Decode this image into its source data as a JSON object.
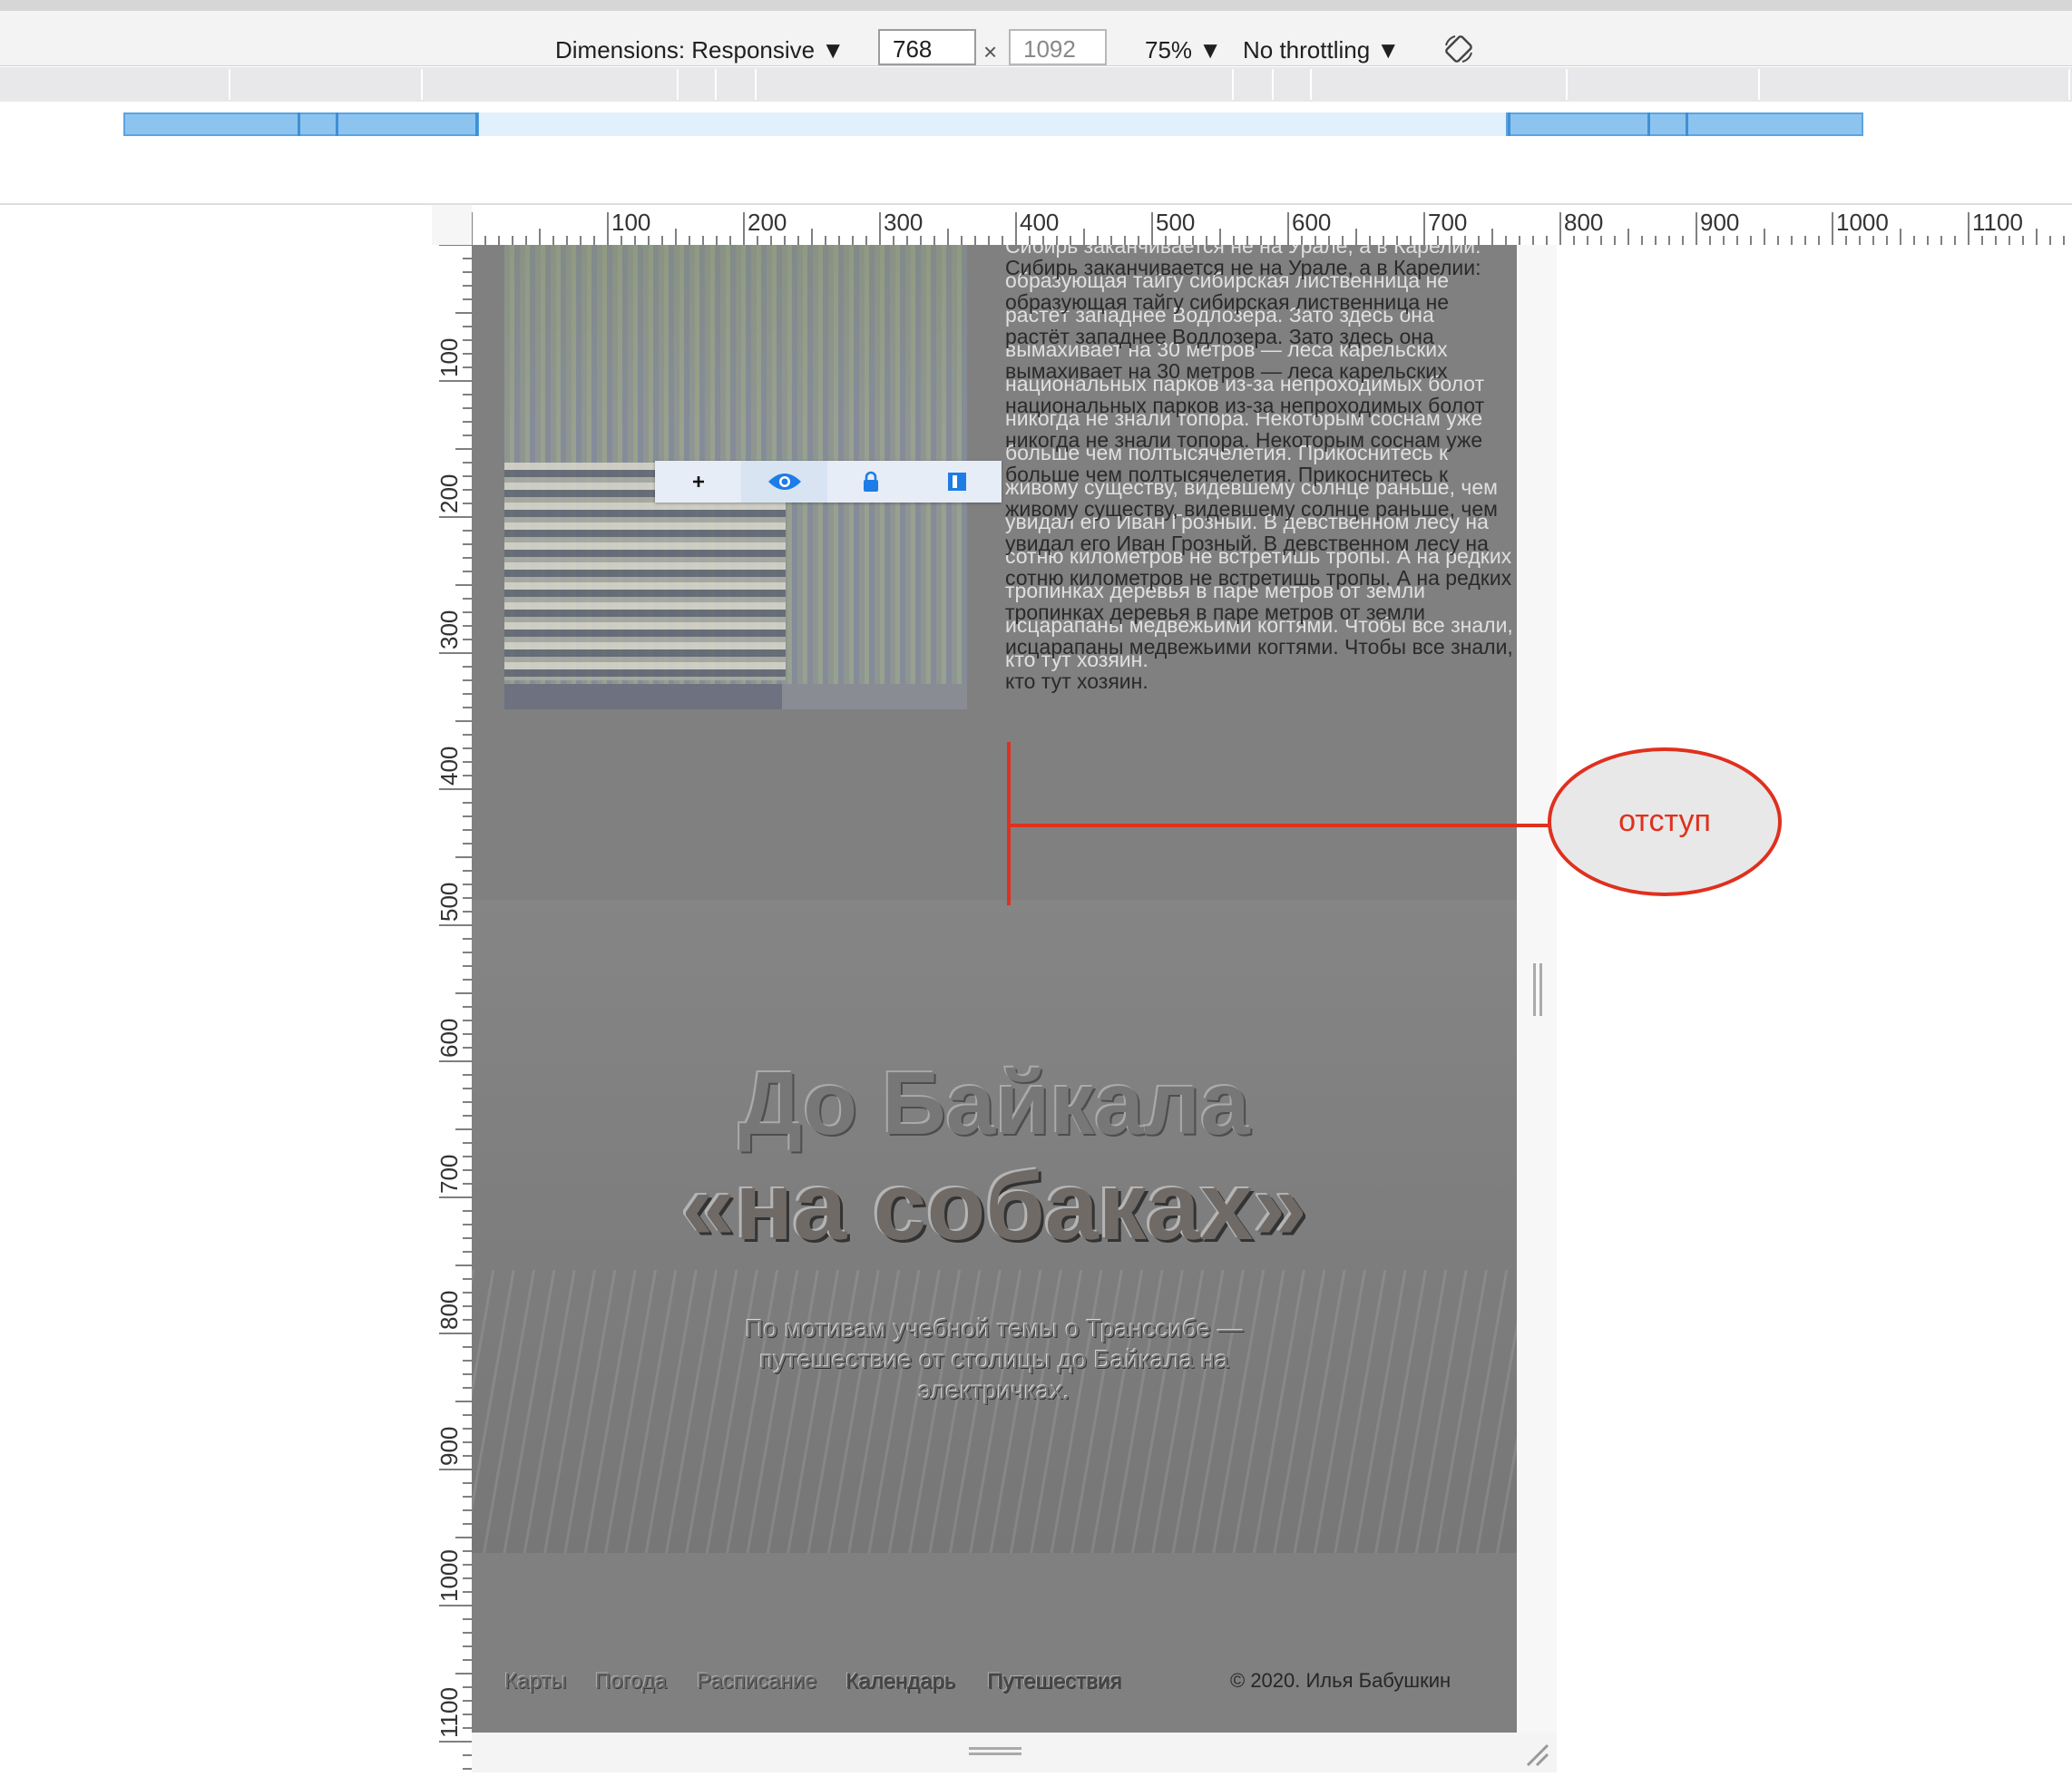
{
  "toolbar": {
    "dimensions_label": "Dimensions: Responsive ▼",
    "width_value": "768",
    "times": "×",
    "height_placeholder": "1092",
    "zoom": "75% ▼",
    "throttling": "No throttling ▼"
  },
  "ruler": {
    "top": [
      "100",
      "200",
      "300",
      "400",
      "500",
      "600",
      "700",
      "800",
      "900",
      "1000",
      "1100"
    ],
    "left": [
      "100",
      "200",
      "300",
      "400",
      "500",
      "600",
      "700",
      "800",
      "900",
      "1000",
      "1100"
    ]
  },
  "article": {
    "ghost": "Сибирь заканчивается не на Урале, а в Карелии: образующая тайгу сибирская лиственница не растёт западнее Водлозера. Зато здесь она вымахивает на 30 метров — леса карельских национальных парков из-за непроходимых болот никогда не знали топора. Некоторым соснам уже больше чем полтысячелетия. Прикоснитесь к живому существу, видевшему солнце раньше, чем увидал его Иван Грозный. В девственном лесу на сотню километров не встретишь тропы. А на редких тропинках деревья в паре метров от земли исцарапаны медвежьими когтями. Чтобы все знали, кто тут хозяин.",
    "text": "Сибирь заканчивается не на Урале, а в Карелии: образующая тайгу сибирская лиственница не растёт западнее Водлозера. Зато здесь она вымахивает на 30 метров — леса карельских национальных парков из-за непроходимых болот никогда не знали топора. Некоторым соснам уже больше чем полтысячелетия. Прикоснитесь к живому существу, видевшему солнце раньше, чем увидал его Иван Грозный. В девственном лесу на сотню километров не встретишь тропы. А на редких тропинках деревья в паре метров от земли исцарапаны медвежьими когтями. Чтобы все знали, кто тут хозяин."
  },
  "hero": {
    "title_line1": "До Байкала",
    "title_line2": "«на собаках»",
    "subtitle": "По мотивам учебной темы о Транссибе — путешествие от столицы до Байкала на электричках."
  },
  "footer": {
    "links": [
      "Карты",
      "Погода",
      "Расписание",
      "Календарь",
      "Путешествия"
    ],
    "copyright": "© 2020. Илья Бабушкин"
  },
  "annotation": {
    "label": "отступ",
    "color": "#e0301e"
  },
  "overlay_toolbar": {
    "icons": [
      "plus-icon",
      "eye-icon",
      "lock-icon",
      "split-icon"
    ],
    "accent": "#1e7ce6"
  }
}
